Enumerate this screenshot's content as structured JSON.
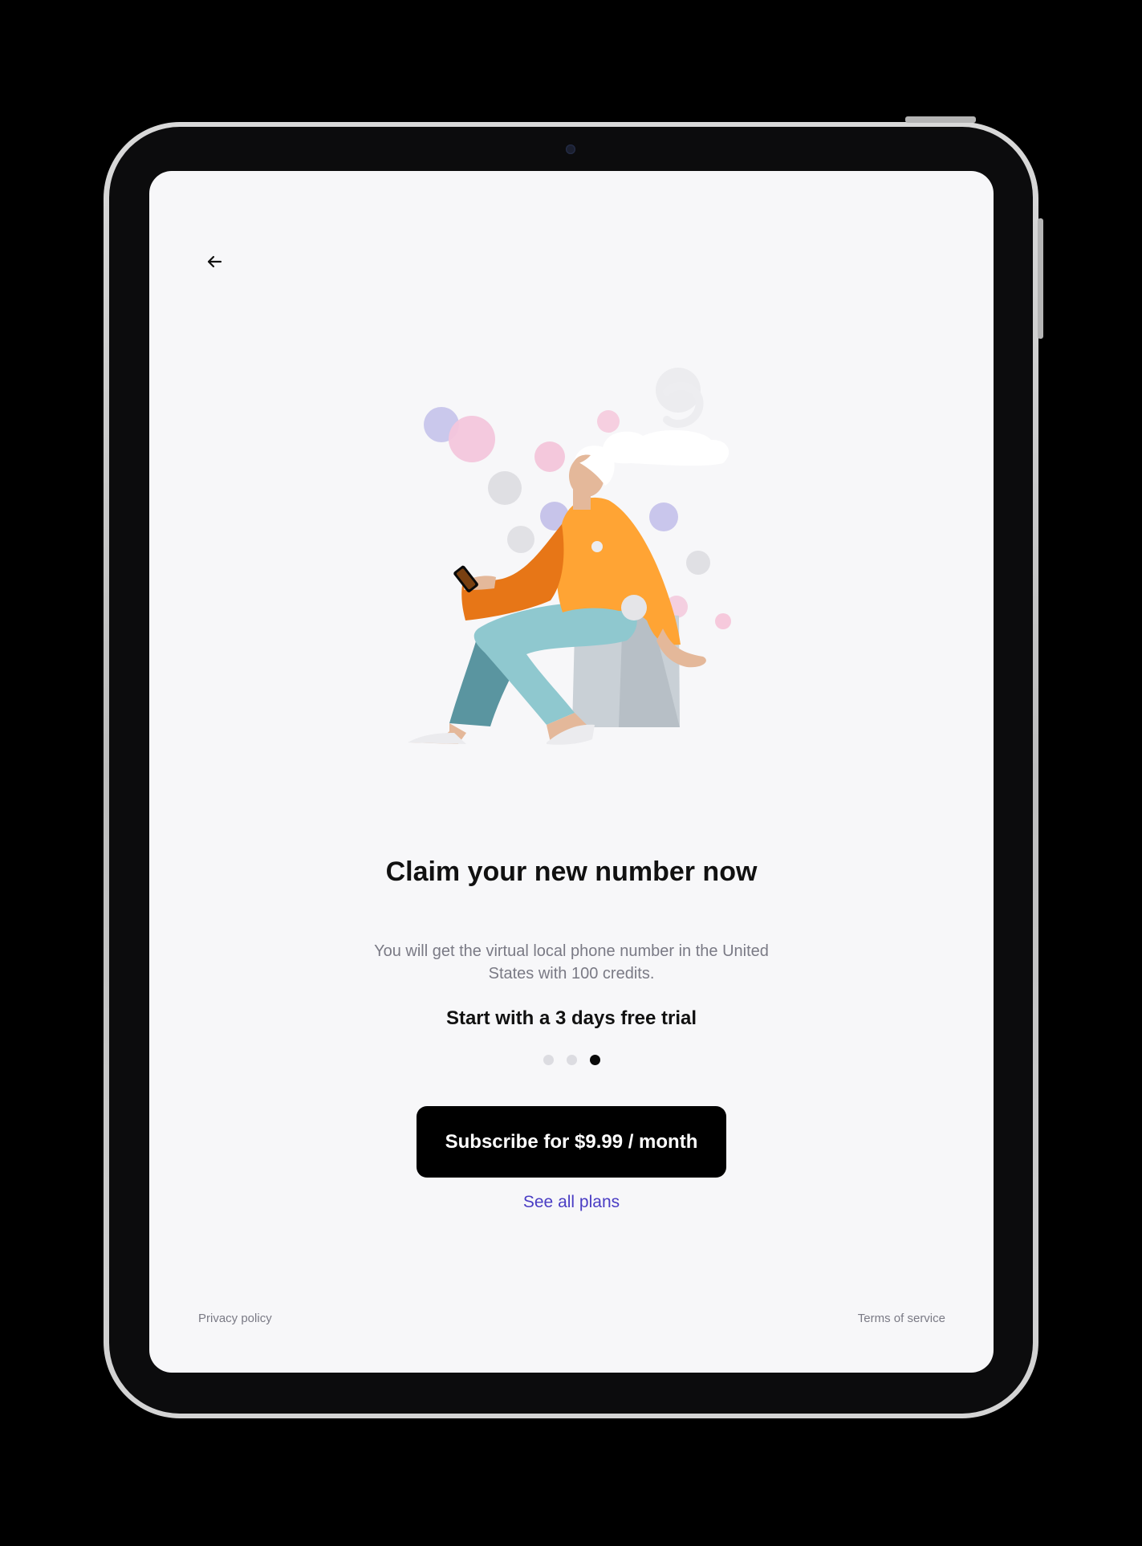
{
  "device": {
    "type": "tablet"
  },
  "nav": {
    "back_icon": "arrow-left-icon"
  },
  "illustration": {
    "name": "person-sitting-with-phone"
  },
  "content": {
    "title": "Claim your new number now",
    "subtitle": "You will get the virtual local phone number in the United States with 100 credits.",
    "trial_text": "Start with a 3 days free trial"
  },
  "pagination": {
    "total": 3,
    "active_index": 2
  },
  "actions": {
    "subscribe_label": "Subscribe for $9.99 / month",
    "see_plans_label": "See all plans"
  },
  "footer": {
    "privacy_label": "Privacy policy",
    "terms_label": "Terms of service"
  },
  "colors": {
    "screen_background": "#f7f7f9",
    "primary_button": "#000000",
    "link": "#4a3dc4",
    "muted_text": "#7a7a85"
  }
}
